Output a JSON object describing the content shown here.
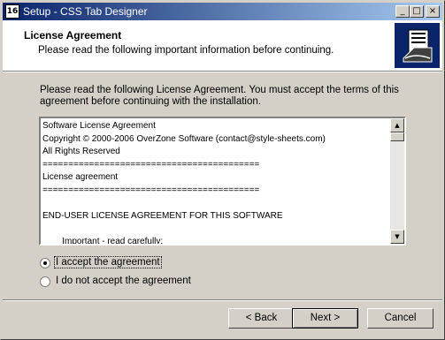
{
  "window": {
    "title": "Setup - CSS Tab Designer",
    "icon_text": "16"
  },
  "header": {
    "title": "License Agreement",
    "subtitle": "Please read the following important information before continuing."
  },
  "intro_text": "Please read the following License Agreement. You must accept the terms of this agreement before continuing with the installation.",
  "license_lines": [
    "Software License Agreement",
    "Copyright © 2000-2006 OverZone Software (contact@style-sheets.com)",
    "All Rights Reserved",
    "==========================================",
    "License agreement",
    "==========================================",
    "",
    "END-USER LICENSE AGREEMENT FOR THIS SOFTWARE",
    "",
    "        Important - read carefully:"
  ],
  "options": {
    "accept": "I accept the agreement",
    "decline": "I do not accept the agreement",
    "selected": "accept"
  },
  "buttons": {
    "back": "< Back",
    "next": "Next >",
    "cancel": "Cancel"
  }
}
